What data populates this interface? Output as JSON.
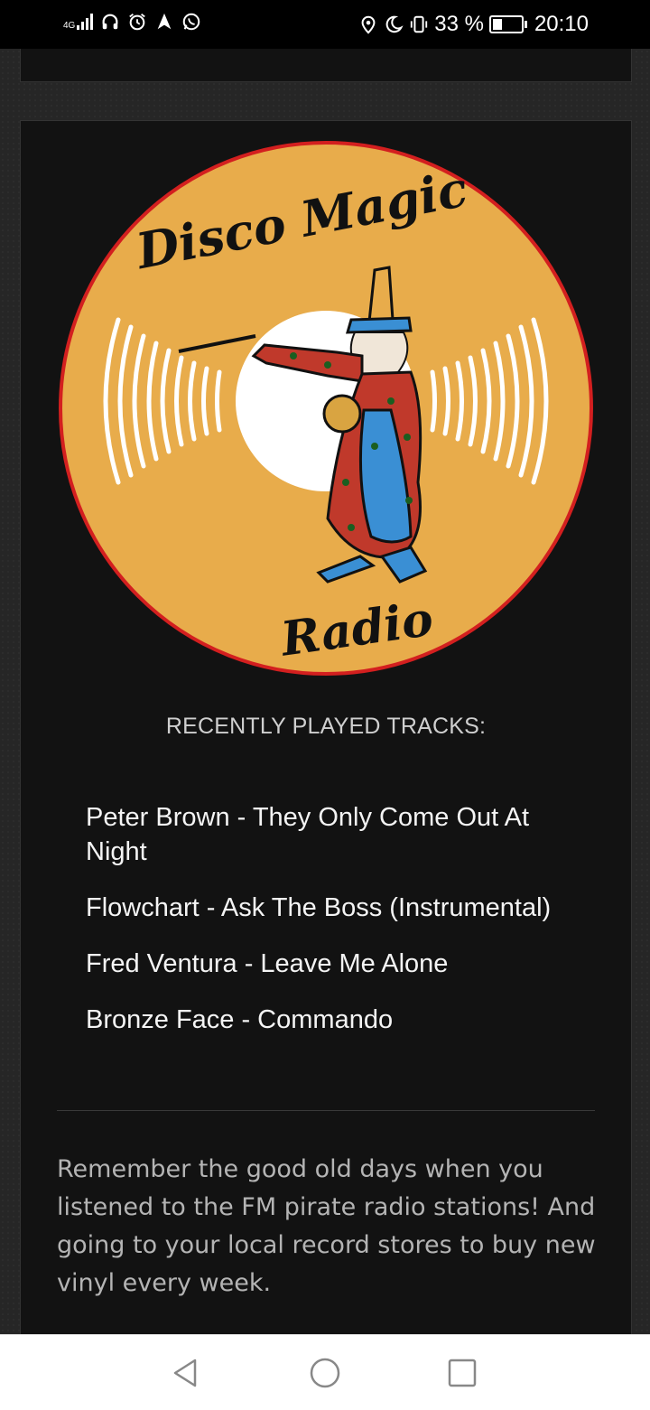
{
  "status_bar": {
    "network": "4G",
    "battery_percent": "33 %",
    "battery_level": 0.33,
    "time": "20:10",
    "icons_left": [
      "signal-icon",
      "headset-icon",
      "alarm-icon",
      "navigation-icon",
      "whatsapp-icon"
    ],
    "icons_right": [
      "location-icon",
      "do-not-disturb-icon",
      "vibrate-icon",
      "battery-icon"
    ]
  },
  "logo": {
    "title": "Disco Magic",
    "subtitle": "Radio",
    "colors": {
      "disc": "#E8AC4B",
      "rim": "#D31F1F",
      "center": "#FFFFFF",
      "wizard_robe": "#C0392B",
      "wizard_blue": "#3A8FD4"
    }
  },
  "recent": {
    "heading": "RECENTLY PLAYED TRACKS:",
    "tracks": [
      "Peter Brown - They Only Come Out At Night",
      "Flowchart - Ask The Boss (Instrumental)",
      "Fred Ventura - Leave Me Alone",
      "Bronze Face - Commando"
    ]
  },
  "blurb": "Remember the good old days when you listened to the FM pirate radio stations! And going to your local record stores to buy new vinyl every week.",
  "nav": {
    "back": "back-icon",
    "home": "home-icon",
    "recents": "recents-icon"
  }
}
